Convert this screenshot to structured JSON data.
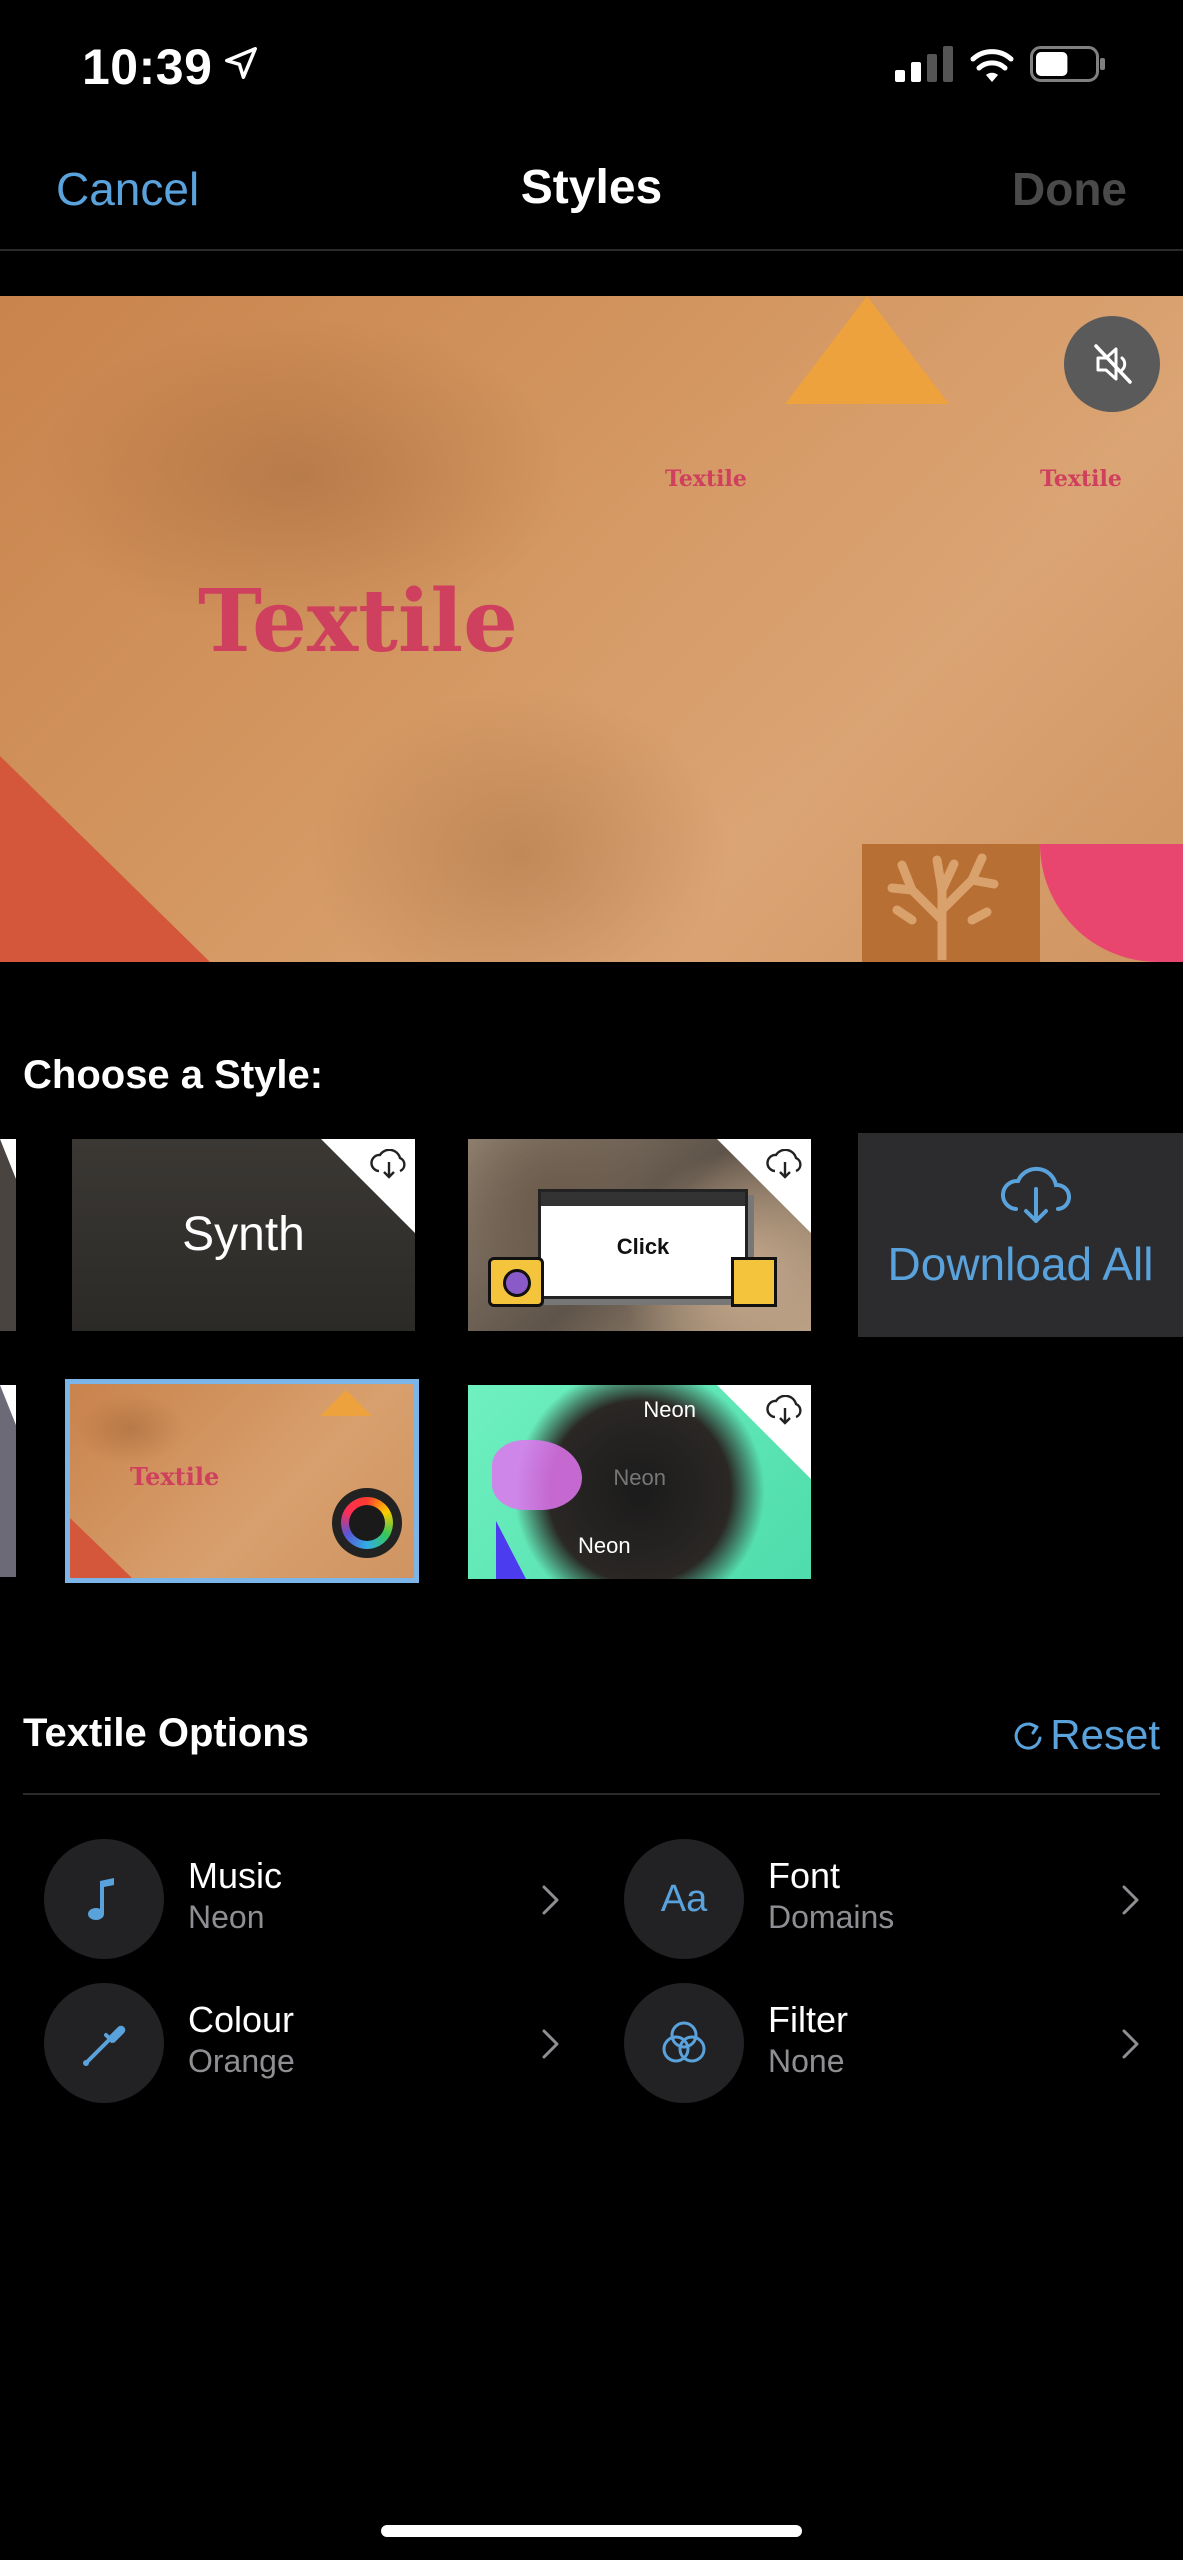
{
  "status_bar": {
    "time": "10:39",
    "battery_level": 0.55
  },
  "nav": {
    "cancel": "Cancel",
    "title": "Styles",
    "done": "Done"
  },
  "preview": {
    "title": "Textile",
    "small_label_1": "Textile",
    "small_label_2": "Textile"
  },
  "choose": {
    "label": "Choose a Style:",
    "tiles": {
      "synth": "Synth",
      "click": "Click",
      "download_all": "Download All",
      "textile": "Textile",
      "neon_1": "Neon",
      "neon_2": "Neon",
      "neon_3": "Neon"
    },
    "selected": "Textile"
  },
  "options": {
    "title": "Textile Options",
    "reset": "Reset",
    "items": [
      {
        "label": "Music",
        "value": "Neon",
        "icon": "music-note-icon"
      },
      {
        "label": "Font",
        "value": "Domains",
        "icon": "font-aa-icon"
      },
      {
        "label": "Colour",
        "value": "Orange",
        "icon": "eyedropper-icon"
      },
      {
        "label": "Filter",
        "value": "None",
        "icon": "filter-circles-icon"
      }
    ]
  },
  "colors": {
    "accent": "#5aa2dc",
    "done_disabled": "#4a4a4a",
    "background": "#000000"
  }
}
